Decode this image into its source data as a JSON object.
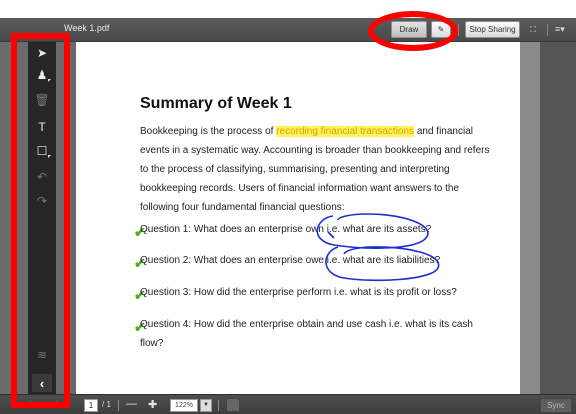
{
  "window": {
    "doc_title": "Week 1.pdf"
  },
  "toolbar": {
    "draw_label": "Draw",
    "pen_label": "✎",
    "stop_sharing_label": "Stop Sharing",
    "fullscreen_label": "⛶",
    "menu_label": "≡▾"
  },
  "tools": [
    {
      "name": "select",
      "glyph": "➤"
    },
    {
      "name": "pen",
      "glyph": "♟"
    },
    {
      "name": "delete",
      "glyph": "🗑"
    },
    {
      "name": "text",
      "glyph": "T"
    },
    {
      "name": "shape",
      "glyph": "☐"
    },
    {
      "name": "undo",
      "glyph": "↶"
    },
    {
      "name": "redo",
      "glyph": "↷"
    }
  ],
  "rail": {
    "layers_glyph": "≋",
    "back_glyph": "‹"
  },
  "document": {
    "heading": "Summary of Week 1",
    "para_before": "Bookkeeping is the process of ",
    "para_highlight": "recording financial transactions",
    "para_after": " and financial events in a systematic way. Accounting is broader than bookkeeping and refers to the process of classifying, summarising, presenting and interpreting bookkeeping records. Users of financial information want answers to the following four fundamental financial questions:",
    "questions": [
      "Question 1: What does an enterprise own i.e. what are its assets?",
      "Question 2: What does an enterprise owe i.e. what are its liabilities?",
      "Question 3: How did the enterprise perform i.e. what is its profit or loss?",
      "Question 4: How did the enterprise obtain and use cash i.e. what is its cash flow?"
    ],
    "check_glyph": "✔"
  },
  "bottom": {
    "page_current": "1",
    "page_total": "/ 1",
    "zoom_out": "—",
    "zoom_in": "✚",
    "zoom_value": "122%",
    "zoom_dropdown": "▼",
    "sync_label": "Sync"
  },
  "colors": {
    "highlight": "#fff35c",
    "annotation_ink": "#1a2fd0",
    "check": "#4caf22",
    "red_markup": "#ff0000"
  }
}
